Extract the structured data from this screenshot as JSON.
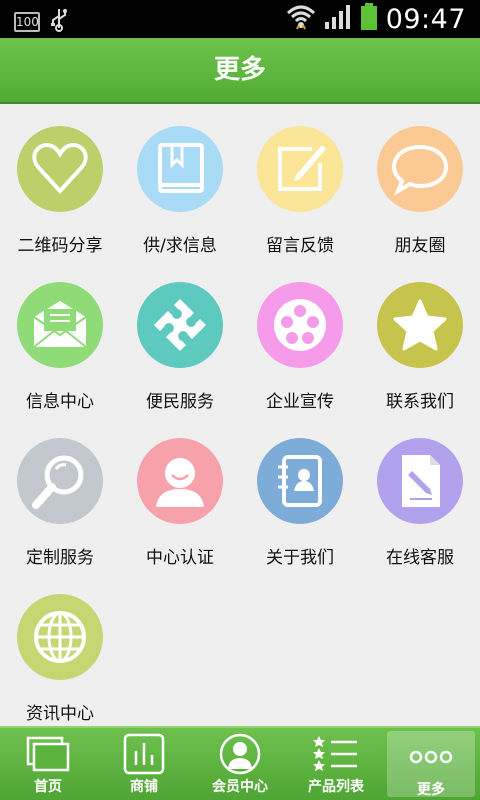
{
  "status_bar": {
    "battery_small": "100",
    "time": "09:47"
  },
  "header": {
    "title": "更多"
  },
  "colors": {
    "accent": "#5ab63c",
    "share": "#bbcf6b",
    "supply": "#a9daf6",
    "feedback": "#fbe596",
    "friends": "#fbc993",
    "info_center": "#8fdb77",
    "convenience": "#5ec9bf",
    "enterprise": "#f59bea",
    "contact": "#c7c44d",
    "custom": "#c3c8cf",
    "auth": "#f7a2ab",
    "about": "#7eacd9",
    "service": "#b2a2ee",
    "news": "#c5d673"
  },
  "grid": {
    "items": [
      {
        "label": "二维码分享",
        "icon": "heart-icon"
      },
      {
        "label": "供/求信息",
        "icon": "book-icon"
      },
      {
        "label": "留言反馈",
        "icon": "edit-icon"
      },
      {
        "label": "朋友圈",
        "icon": "speech-bubble-icon"
      },
      {
        "label": "信息中心",
        "icon": "envelope-icon"
      },
      {
        "label": "便民服务",
        "icon": "puzzle-icon"
      },
      {
        "label": "企业宣传",
        "icon": "film-reel-icon"
      },
      {
        "label": "联系我们",
        "icon": "star-icon"
      },
      {
        "label": "定制服务",
        "icon": "magnifier-icon"
      },
      {
        "label": "中心认证",
        "icon": "user-icon"
      },
      {
        "label": "关于我们",
        "icon": "contact-book-icon"
      },
      {
        "label": "在线客服",
        "icon": "document-pen-icon"
      },
      {
        "label": "资讯中心",
        "icon": "globe-icon"
      }
    ]
  },
  "bottom_nav": {
    "items": [
      {
        "label": "首页",
        "icon": "pages-icon"
      },
      {
        "label": "商铺",
        "icon": "shop-chart-icon"
      },
      {
        "label": "会员中心",
        "icon": "member-icon"
      },
      {
        "label": "产品列表",
        "icon": "star-list-icon"
      },
      {
        "label": "更多",
        "icon": "more-dots-icon"
      }
    ]
  }
}
